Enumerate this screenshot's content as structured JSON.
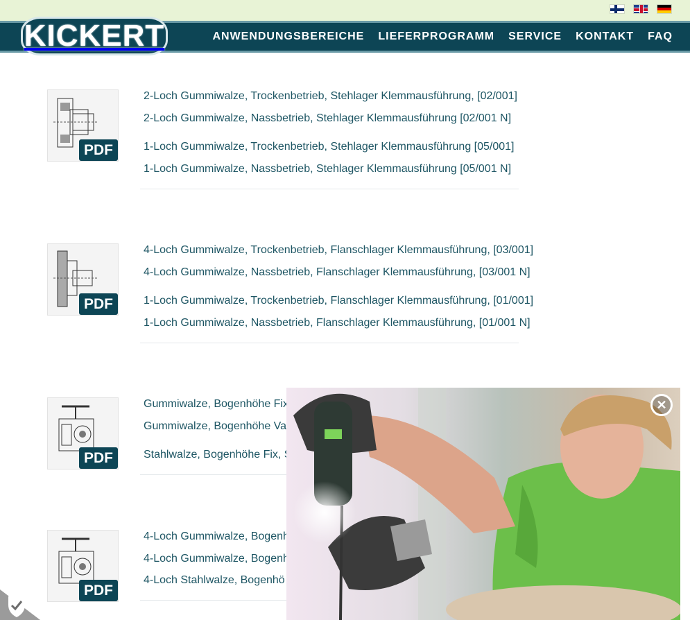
{
  "brand": {
    "logo_text": "KICKERT"
  },
  "language_flags": [
    "finnish-flag-icon",
    "english-flag-icon",
    "german-flag-icon"
  ],
  "nav": {
    "items": [
      "ANWENDUNGSBEREICHE",
      "LIEFERPROGRAMM",
      "SERVICE",
      "KONTAKT",
      "FAQ"
    ]
  },
  "colors": {
    "brand_dark": "#0d4555",
    "top_bar": "#e8f3d6",
    "link": "#1d5563",
    "accent_green": "#7cc142"
  },
  "groups": [
    {
      "pdf_label": "PDF",
      "links": [
        "2-Loch Gummiwalze, Trockenbetrieb, Stehlager Klemmausführung, [02/001]",
        "2-Loch Gummiwalze, Nassbetrieb, Stehlager Klemmausführung [02/001 N]",
        "1-Loch Gummiwalze, Trockenbetrieb, Stehlager Klemmausführung [05/001]",
        "1-Loch Gummiwalze, Nassbetrieb, Stehlager Klemmausführung [05/001 N]"
      ]
    },
    {
      "pdf_label": "PDF",
      "links": [
        "4-Loch Gummiwalze, Trockenbetrieb, Flanschlager Klemmausführung, [03/001]",
        "4-Loch Gummiwalze, Nassbetrieb, Flanschlager Klemmausführung, [03/001 N]",
        "1-Loch Gummiwalze, Trockenbetrieb, Flanschlager Klemmausführung, [01/001]",
        "1-Loch Gummiwalze, Nassbetrieb, Flanschlager Klemmausführung, [01/001 N]"
      ]
    },
    {
      "pdf_label": "PDF",
      "links": [
        "Gummiwalze, Bogenhöhe Fix",
        "Gummiwalze, Bogenhöhe Va",
        "Stahlwalze, Bogenhöhe Fix, S"
      ]
    },
    {
      "pdf_label": "PDF",
      "links": [
        "4-Loch Gummiwalze, Bogenh",
        "4-Loch Gummiwalze, Bogenh",
        "4-Loch Stahlwalze, Bogenhö"
      ]
    }
  ],
  "video_popup": {
    "close_icon": "close-icon"
  },
  "privacy": {
    "icon": "shield-check-icon"
  }
}
